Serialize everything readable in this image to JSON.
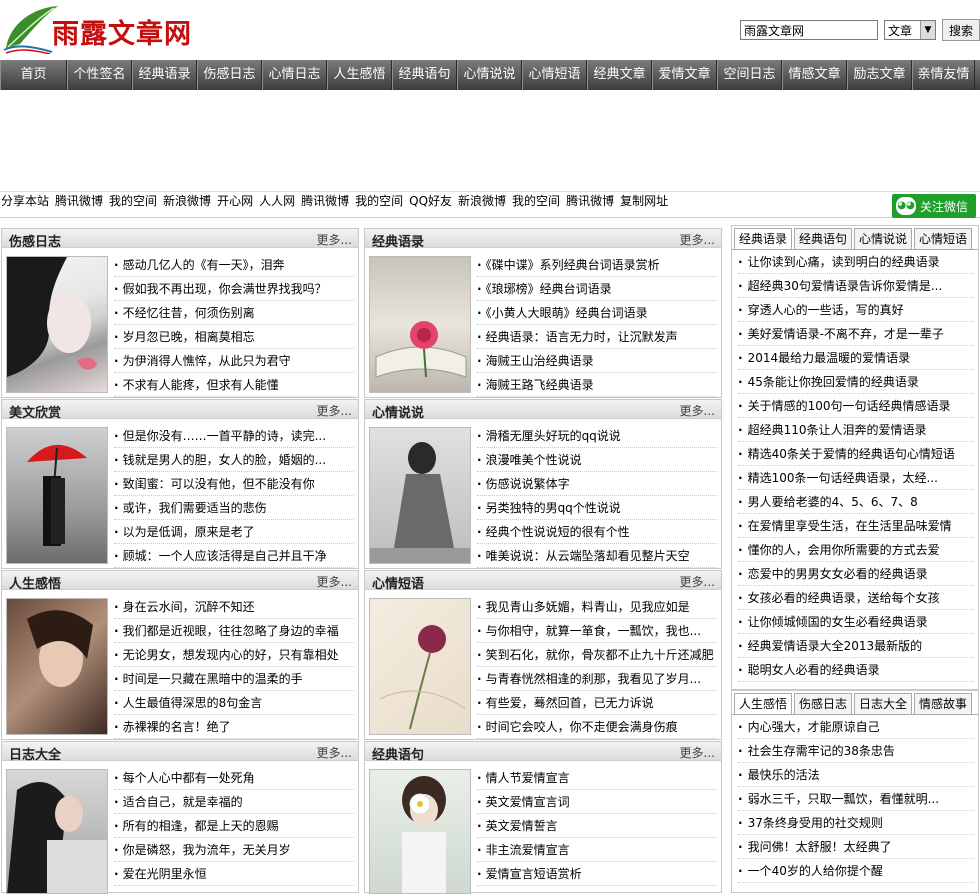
{
  "site": {
    "name": "雨露文章网"
  },
  "search": {
    "value": "雨露文章网",
    "type": "文章",
    "button": "搜索"
  },
  "nav": [
    "首页",
    "个性签名",
    "经典语录",
    "伤感日志",
    "心情日志",
    "人生感悟",
    "经典语句",
    "心情说说",
    "心情短语",
    "经典文章",
    "爱情文章",
    "空间日志",
    "情感文章",
    "励志文章",
    "亲情友情"
  ],
  "share": [
    "分享本站",
    "腾讯微博",
    "我的空间",
    "新浪微博",
    "开心网",
    "人人网",
    "腾讯微博",
    "我的空间",
    "QQ好友",
    "新浪微博",
    "我的空间",
    "腾讯微博",
    "复制网址"
  ],
  "wechat": "关注微信",
  "more": "更多...",
  "boxes": [
    {
      "title": "伤感日志",
      "items": [
        "感动几亿人的《有一天》，泪奔",
        "假如我不再出现，你会满世界找我吗？",
        "不经忆往昔，何须伤别离",
        "岁月忽已晚，相离莫相忘",
        "为伊消得人憔悴，从此只为君守",
        "不求有人能疼，但求有人能懂"
      ]
    },
    {
      "title": "经典语录",
      "items": [
        "《碟中谍》系列经典台词语录赏析",
        "《琅琊榜》经典台词语录",
        "《小黄人大眼萌》经典台词语录",
        "经典语录：语言无力时，让沉默发声",
        "海贼王山治经典语录",
        "海贼王路飞经典语录"
      ]
    },
    {
      "title": "美文欣赏",
      "items": [
        "但是你没有……一首平静的诗，读完...",
        "钱就是男人的胆，女人的脸，婚姻的...",
        "致闺蜜：可以没有他，但不能没有你",
        "或许，我们需要适当的悲伤",
        "以为是低调，原来是老了",
        "顾城：一个人应该活得是自己并且干净"
      ]
    },
    {
      "title": "心情说说",
      "items": [
        "滑稽无厘头好玩的qq说说",
        "浪漫唯美个性说说",
        "伤感说说繁体字",
        "另类独特的男qq个性说说",
        "经典个性说说短的很有个性",
        "唯美说说：从云端坠落却看见整片天空"
      ]
    },
    {
      "title": "人生感悟",
      "items": [
        "身在云水间，沉醉不知还",
        "我们都是近视眼，往往忽略了身边的幸福",
        "无论男女，想发现内心的好，只有靠相处",
        "时间是一只藏在黑暗中的温柔的手",
        "人生最值得深思的8句金言",
        "赤裸裸的名言！绝了"
      ]
    },
    {
      "title": "心情短语",
      "items": [
        "我见青山多妩媚，料青山，见我应如是",
        "与你相守，就算一箪食，一瓢饮，我也...",
        "笑到石化，就你，骨灰都不止九十斤还减肥",
        "与青春恍然相逢的刹那，我看见了岁月...",
        "有些爱，蓦然回首，已无力诉说",
        "时间它会咬人，你不走便会满身伤痕"
      ]
    },
    {
      "title": "日志大全",
      "items": [
        "每个人心中都有一处死角",
        "适合自己，就是幸福的",
        "所有的相逢，都是上天的恩赐",
        "你是磷怒，我为流年，无关月岁",
        "爱在光阴里永恒"
      ]
    },
    {
      "title": "经典语句",
      "items": [
        "情人节爱情宣言",
        "英文爱情宣言词",
        "英文爱情誓言",
        "非主流爱情宣言",
        "爱情宣言短语赏析"
      ]
    }
  ],
  "side1": {
    "tabs": [
      "经典语录",
      "经典语句",
      "心情说说",
      "心情短语"
    ],
    "items": [
      "让你读到心痛，读到明白的经典语录",
      "超经典30句爱情语录告诉你爱情是...",
      "穿透人心的一些话，写的真好",
      "美好爱情语录-不离不弃，才是一辈子",
      "2014最给力最温暖的爱情语录",
      "45条能让你挽回爱情的经典语录",
      "关于情感的100句一句话经典情感语录",
      "超经典110条让人泪奔的爱情语录",
      "精选40条关于爱情的经典语句心情短语",
      "精选100条一句话经典语录，太经...",
      "男人要给老婆的4、5、6、7、8",
      "在爱情里享受生活，在生活里品味爱情",
      "懂你的人，会用你所需要的方式去爱",
      "恋爱中的男男女女必看的经典语录",
      "女孩必看的经典语录，送给每个女孩",
      "让你倾城倾国的女生必看经典语录",
      "经典爱情语录大全2013最新版的",
      "聪明女人必看的经典语录"
    ]
  },
  "side2": {
    "tabs": [
      "人生感悟",
      "伤感日志",
      "日志大全",
      "情感故事"
    ],
    "items": [
      "内心强大，才能原谅自己",
      "社会生存需牢记的38条忠告",
      "最快乐的活法",
      "弱水三千，只取一瓢饮，看懂就明...",
      "37条终身受用的社交规则",
      "我问佛！太舒服！太经典了",
      "一个40岁的人给你提个醒"
    ]
  }
}
